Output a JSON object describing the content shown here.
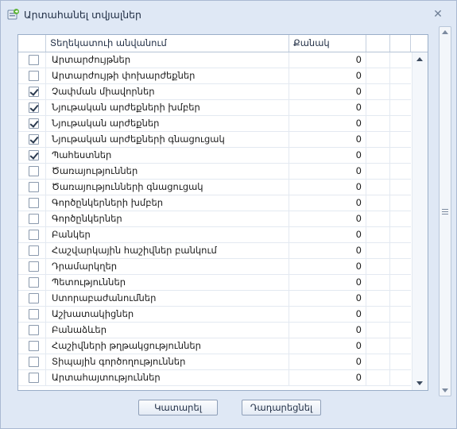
{
  "window": {
    "title": "Արտահանել տվյալներ",
    "close_icon": "close-icon",
    "app_icon": "export-icon"
  },
  "grid": {
    "columns": [
      "",
      "Տեղեկատուի անվանում",
      "Քանակ",
      "",
      ""
    ],
    "rows": [
      {
        "name": "Արտարժույթներ",
        "qty": "0",
        "checked": false
      },
      {
        "name": "Արտարժույթի փոխարժեքներ",
        "qty": "0",
        "checked": false
      },
      {
        "name": "Չափման միավորներ",
        "qty": "0",
        "checked": true
      },
      {
        "name": "Նյութական արժեքների խմբեր",
        "qty": "0",
        "checked": true
      },
      {
        "name": "Նյութական արժեքներ",
        "qty": "0",
        "checked": true
      },
      {
        "name": "Նյութական արժեքների գնացուցակ",
        "qty": "0",
        "checked": true
      },
      {
        "name": "Պահեստներ",
        "qty": "0",
        "checked": true
      },
      {
        "name": "Ծառայություններ",
        "qty": "0",
        "checked": false
      },
      {
        "name": "Ծառայությունների գնացուցակ",
        "qty": "0",
        "checked": false
      },
      {
        "name": "Գործընկերների խմբեր",
        "qty": "0",
        "checked": false
      },
      {
        "name": "Գործընկերներ",
        "qty": "0",
        "checked": false
      },
      {
        "name": "Բանկեր",
        "qty": "0",
        "checked": false
      },
      {
        "name": "Հաշվարկային հաշիվներ բանկում",
        "qty": "0",
        "checked": false
      },
      {
        "name": "Դրամարկղեր",
        "qty": "0",
        "checked": false
      },
      {
        "name": "Պետություններ",
        "qty": "0",
        "checked": false
      },
      {
        "name": "Ստորաբաժանումներ",
        "qty": "0",
        "checked": false
      },
      {
        "name": "Աշխատակիցներ",
        "qty": "0",
        "checked": false
      },
      {
        "name": "Բանաձևեր",
        "qty": "0",
        "checked": false
      },
      {
        "name": "Հաշիվների թղթակցություններ",
        "qty": "0",
        "checked": false
      },
      {
        "name": "Տիպային գործողություններ",
        "qty": "0",
        "checked": false
      },
      {
        "name": "Արտահայտություններ",
        "qty": "0",
        "checked": false
      }
    ]
  },
  "buttons": {
    "run_label": "Կատարել",
    "cancel_label": "Դադարեցնել"
  },
  "colors": {
    "window_bg": "#dfe8f5",
    "grid_border": "#9aaec8",
    "checkmark": "#2b3a4f"
  }
}
